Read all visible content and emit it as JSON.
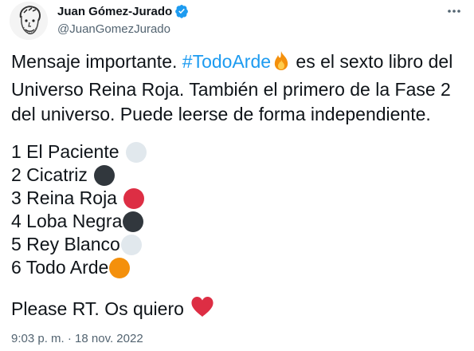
{
  "author": {
    "display_name": "Juan Gómez-Jurado",
    "handle": "@JuanGomezJurado",
    "verified_icon": "verified-badge-icon"
  },
  "more_icon": "more-options-icon",
  "tweet": {
    "intro": {
      "before_hashtag": "Mensaje importante. ",
      "hashtag": "#TodoArde",
      "hashtag_emoji": "fire-emoji-icon",
      "after_hashtag": " es el sexto libro del",
      "line2": "Universo Reina Roja. También el primero de la Fase 2",
      "line3": "del universo. Puede leerse de forma independiente."
    },
    "books": [
      {
        "label": "1 El Paciente",
        "circle_color": "#e1e8ed"
      },
      {
        "label": "2 Cicatriz",
        "circle_color": "#31373d"
      },
      {
        "label": "3 Reina Roja",
        "circle_color": "#dd2e44"
      },
      {
        "label": "4 Loba Negra",
        "circle_color": "#31373d"
      },
      {
        "label": "5 Rey Blanco",
        "circle_color": "#e1e8ed"
      },
      {
        "label": "6 Todo Arde",
        "circle_color": "#f4900c"
      }
    ],
    "closing": "Please RT. Os quiero",
    "closing_emoji": "red-heart-emoji-icon"
  },
  "timestamp": "9:03 p. m. · 18 nov. 2022",
  "colors": {
    "link": "#1d9bf0",
    "secondary_text": "#536471",
    "primary_text": "#0f1419"
  }
}
